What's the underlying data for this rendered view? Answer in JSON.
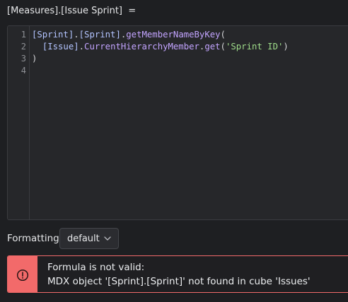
{
  "header": {
    "measure_title": "[Measures].[Issue Sprint]  ="
  },
  "editor": {
    "line_numbers": [
      "1",
      "2",
      "3",
      "4"
    ],
    "lines": [
      {
        "tokens": [
          {
            "text": "[Sprint]",
            "kind": "id"
          },
          {
            "text": ".",
            "kind": "plain"
          },
          {
            "text": "[Sprint]",
            "kind": "id"
          },
          {
            "text": ".",
            "kind": "plain"
          },
          {
            "text": "getMemberNameByKey",
            "kind": "fn"
          },
          {
            "text": "(",
            "kind": "plain"
          }
        ]
      },
      {
        "tokens": [
          {
            "text": "  ",
            "kind": "plain"
          },
          {
            "text": "[Issue]",
            "kind": "id"
          },
          {
            "text": ".",
            "kind": "plain"
          },
          {
            "text": "CurrentHierarchyMember",
            "kind": "fn"
          },
          {
            "text": ".",
            "kind": "plain"
          },
          {
            "text": "get",
            "kind": "fn"
          },
          {
            "text": "(",
            "kind": "plain"
          },
          {
            "text": "'Sprint ID'",
            "kind": "str"
          },
          {
            "text": ")",
            "kind": "plain"
          }
        ]
      },
      {
        "tokens": [
          {
            "text": ")",
            "kind": "plain"
          }
        ]
      },
      {
        "tokens": []
      }
    ]
  },
  "formatting": {
    "label": "Formatting",
    "selected": "default"
  },
  "error": {
    "title": "Formula is not valid:",
    "message": "MDX object '[Sprint].[Sprint]' not found in cube 'Issues'"
  },
  "colors": {
    "background": "#1e1f22",
    "editor_background": "#26272a",
    "identifier": "#b3c4ff",
    "function": "#c3a4ff",
    "string": "#9fdd8a",
    "error_accent": "#f26a6a"
  },
  "icons": {
    "format_dropdown": "chevron-down-icon",
    "error": "exclamation-circle-icon"
  }
}
